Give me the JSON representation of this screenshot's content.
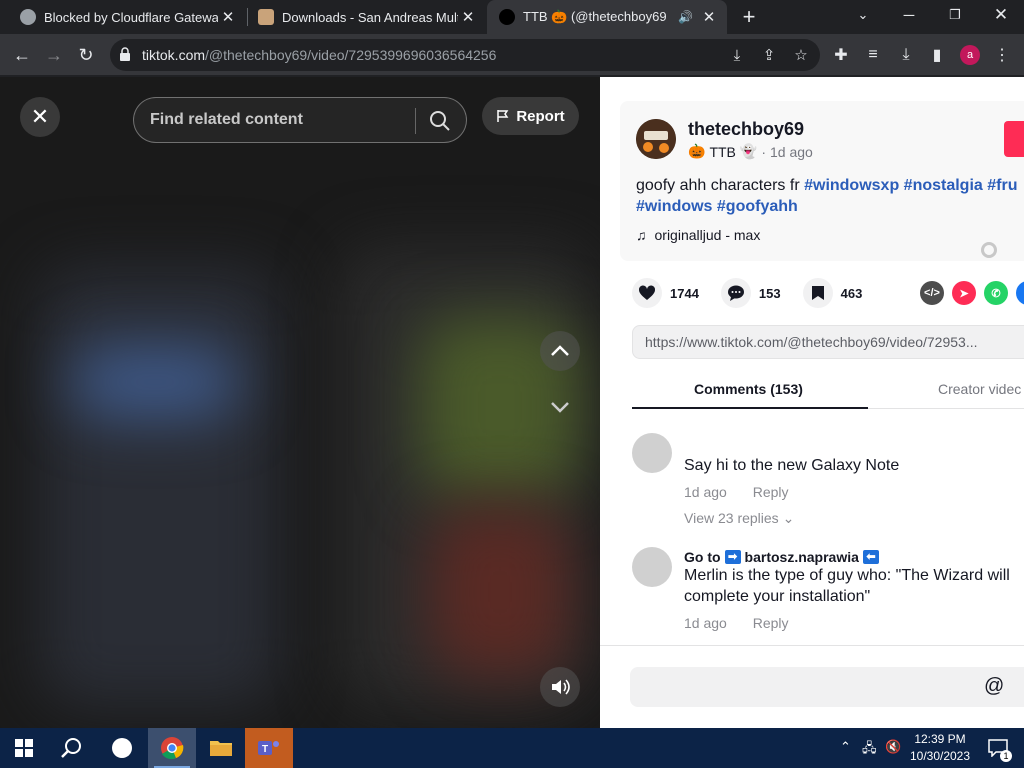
{
  "browser": {
    "tabs": [
      {
        "title": "Blocked by Cloudflare Gateway",
        "active": false
      },
      {
        "title": "Downloads - San Andreas Multip",
        "active": false
      },
      {
        "title": "TTB 🎃 (@thetechboy69",
        "active": true
      }
    ],
    "url_host": "tiktok.com",
    "url_path": "/@thetechboy69/video/7295399696036564256"
  },
  "video": {
    "search_placeholder": "Find related content",
    "report_label": "Report"
  },
  "post": {
    "username": "thetechboy69",
    "nickname": "TTB",
    "time_ago": "1d ago",
    "description_text": "goofy ahh characters fr ",
    "hashtags_line1": "#windowsxp #nostalgia #fru",
    "hashtags_line2": "#windows #goofyahh",
    "music": "originalljud - max",
    "likes": "1744",
    "comments": "153",
    "saves": "463",
    "link": "https://www.tiktok.com/@thetechboy69/video/72953..."
  },
  "tabs": {
    "comments": "Comments (153)",
    "creator": "Creator videc"
  },
  "comments": [
    {
      "user": "",
      "text": "Say hi to the new Galaxy Note",
      "time": "1d ago",
      "reply": "Reply",
      "view_replies": "View 23 replies"
    },
    {
      "user_prefix": "Go to",
      "user_name": "bartosz.naprawia",
      "text_line1": "Merlin is the type of guy who: \"The Wizard will",
      "text_line2": "complete your installation\"",
      "time": "1d ago",
      "reply": "Reply"
    }
  ],
  "taskbar": {
    "time": "12:39 PM",
    "date": "10/30/2023",
    "notifications": "1"
  },
  "colors": {
    "accent": "#fe2c55",
    "hashtag": "#2b5db9",
    "taskbar": "#0c2347"
  }
}
